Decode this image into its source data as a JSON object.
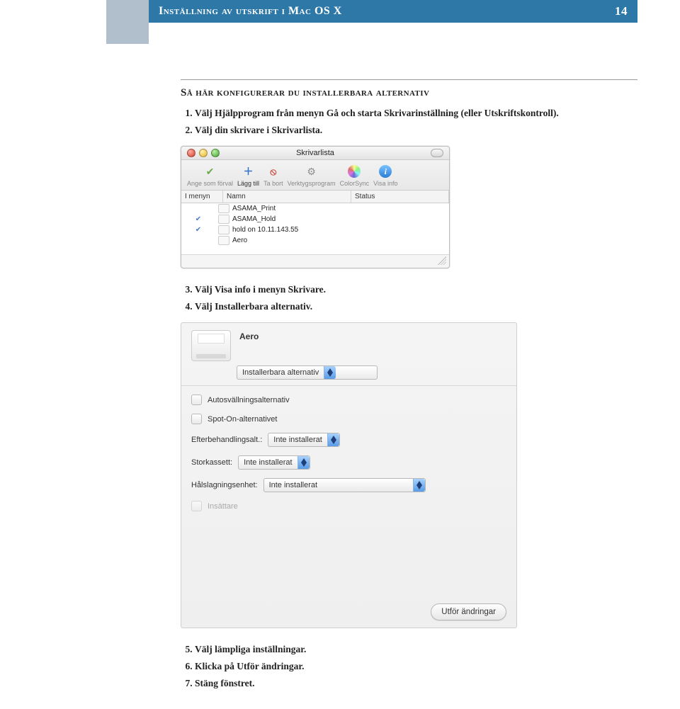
{
  "header": {
    "title": "Inställning av utskrift i Mac OS X",
    "page_num": "14"
  },
  "section": {
    "heading": "Så här konfigurerar du installerbara alternativ"
  },
  "steps": {
    "s1": "Välj Hjälpprogram från menyn Gå och starta Skrivarinställning (eller Utskriftskontroll).",
    "s2": "Välj din skrivare i Skrivarlista.",
    "s3": "Välj Visa info i menyn Skrivare.",
    "s4": "Välj Installerbara alternativ.",
    "s5": "Välj lämpliga inställningar.",
    "s6": "Klicka på Utför ändringar.",
    "s7": "Stäng fönstret."
  },
  "printer_list_window": {
    "title": "Skrivarlista",
    "toolbar": {
      "set_default": "Ange som förval",
      "add": "Lägg till",
      "remove": "Ta bort",
      "utility": "Verktygsprogram",
      "colorsync": "ColorSync",
      "show_info": "Visa info"
    },
    "columns": {
      "menu": "I menyn",
      "name": "Namn",
      "status": "Status"
    },
    "rows": [
      {
        "checked": false,
        "name": "ASAMA_Print"
      },
      {
        "checked": true,
        "name": "ASAMA_Hold"
      },
      {
        "checked": true,
        "name": "hold on 10.11.143.55"
      },
      {
        "checked": false,
        "name": "Aero"
      }
    ]
  },
  "printer_info_pane": {
    "printer_name": "Aero",
    "popup_label": "Installerbara alternativ",
    "options": {
      "auto": {
        "label": "Autosvällningsalternativ",
        "enabled": true
      },
      "spot_on": {
        "label": "Spot-On-alternativet",
        "enabled": true
      },
      "insattare": {
        "label": "Insättare",
        "enabled": false
      }
    },
    "selects": {
      "efter": {
        "label": "Efterbehandlingsalt.:",
        "value": "Inte installerat"
      },
      "stor": {
        "label": "Storkassett:",
        "value": "Inte installerat"
      },
      "hal": {
        "label": "Hålslagningsenhet:",
        "value": "Inte installerat"
      }
    },
    "apply_button": "Utför ändringar"
  }
}
